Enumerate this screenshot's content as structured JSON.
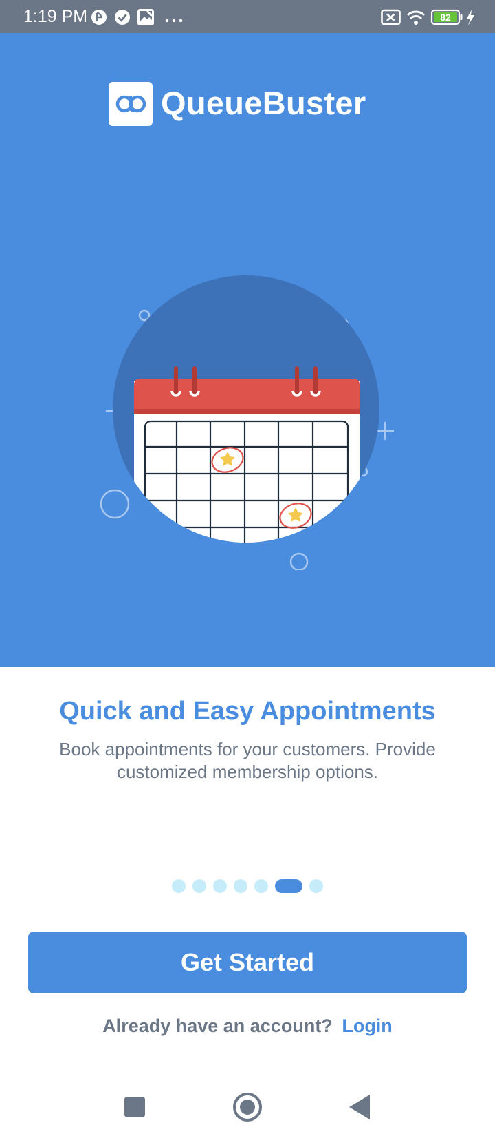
{
  "status_bar": {
    "time": "1:19 PM",
    "battery_level": "82",
    "icons": [
      "app-notification-icon",
      "check-circle-icon",
      "image-icon",
      "more-dots-icon",
      "no-sim-icon",
      "wifi-icon",
      "battery-icon",
      "charging-icon"
    ]
  },
  "brand": {
    "name": "QueueBuster",
    "logo_mark": "qb"
  },
  "slide": {
    "title": "Quick and Easy Appointments",
    "description": "Book appointments for your customers. Provide customized membership options."
  },
  "pager": {
    "total": 7,
    "active_index": 5
  },
  "actions": {
    "primary": "Get Started",
    "login_prompt": "Already have an account?",
    "login_link": "Login"
  },
  "colors": {
    "brand_blue": "#4a8cde",
    "status_gray": "#6b7686",
    "calendar_red": "#de534b",
    "star_yellow": "#f5c94f"
  }
}
